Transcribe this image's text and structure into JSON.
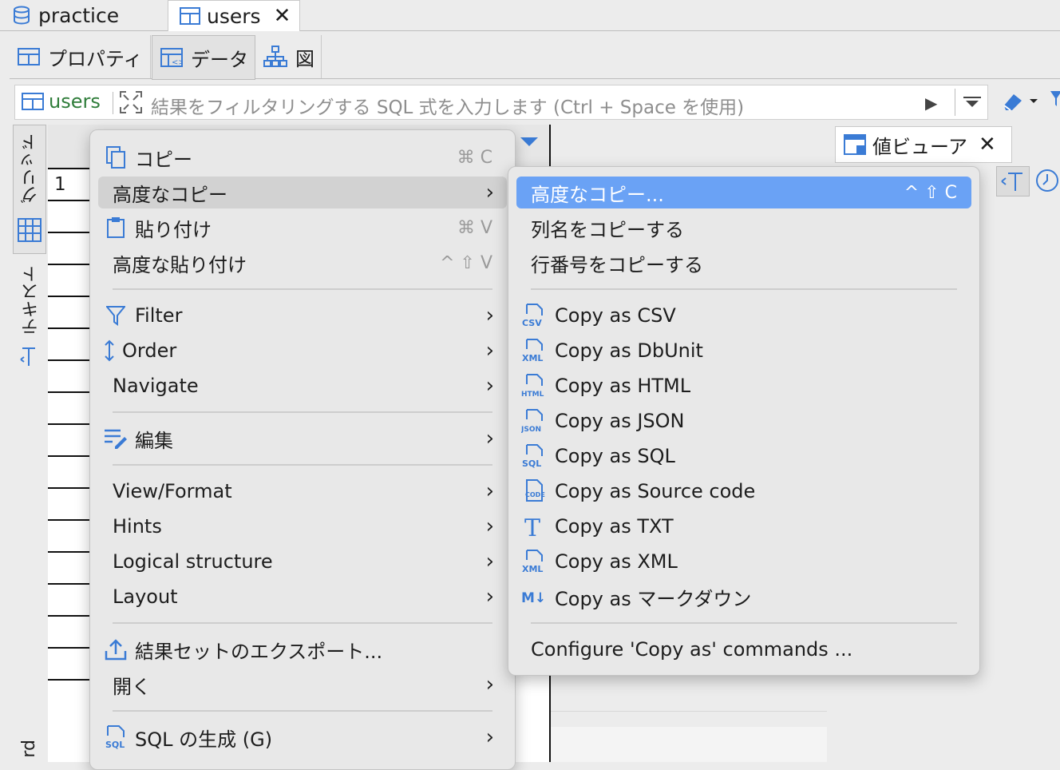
{
  "editor_tabs": [
    {
      "label": "practice",
      "icon": "database-icon"
    },
    {
      "label": "users",
      "icon": "table-icon",
      "close": "✕"
    }
  ],
  "sub_tabs": [
    {
      "label": "プロパティ"
    },
    {
      "label": "データ"
    },
    {
      "label": "図"
    }
  ],
  "filter": {
    "table": "users",
    "placeholder": "結果をフィルタリングする SQL 式を入力します (Ctrl + Space を使用)"
  },
  "grid": {
    "row_number": "1",
    "vertical_tabs": [
      "グリッド",
      "テキスト"
    ],
    "bottom_fragment": "rd"
  },
  "value_viewer": {
    "label": "値ビューア",
    "close": "✕"
  },
  "context_menu": {
    "items": [
      {
        "label": "コピー",
        "shortcut": "⌘ C"
      },
      {
        "label": "高度なコピー",
        "arrow": "›"
      },
      {
        "label": "貼り付け",
        "shortcut": "⌘ V"
      },
      {
        "label": "高度な貼り付け",
        "shortcut": "^ ⇧ V"
      },
      {
        "label": "Filter",
        "arrow": "›"
      },
      {
        "label": "Order",
        "arrow": "›"
      },
      {
        "label": "Navigate",
        "arrow": "›"
      },
      {
        "label": "編集",
        "arrow": "›"
      },
      {
        "label": "View/Format",
        "arrow": "›"
      },
      {
        "label": "Hints",
        "arrow": "›"
      },
      {
        "label": "Logical structure",
        "arrow": "›"
      },
      {
        "label": "Layout",
        "arrow": "›"
      },
      {
        "label": "結果セットのエクスポート...",
        "arrow": ""
      },
      {
        "label": "開く",
        "arrow": "›"
      },
      {
        "label": "SQL の生成 (G)",
        "arrow": "›"
      }
    ]
  },
  "submenu": {
    "items": [
      {
        "label": "高度なコピー...",
        "shortcut": "^ ⇧ C"
      },
      {
        "label": "列名をコピーする"
      },
      {
        "label": "行番号をコピーする"
      },
      {
        "label": "Copy as CSV",
        "badge": "CSV"
      },
      {
        "label": "Copy as DbUnit",
        "badge": "XML"
      },
      {
        "label": "Copy as HTML",
        "badge": "HTML"
      },
      {
        "label": "Copy as JSON",
        "badge": "JSON"
      },
      {
        "label": "Copy as SQL",
        "badge": "SQL"
      },
      {
        "label": "Copy as Source code",
        "badge": "CODE"
      },
      {
        "label": "Copy as TXT",
        "badge": "T"
      },
      {
        "label": "Copy as XML",
        "badge": "XML"
      },
      {
        "label": "Copy as マークダウン",
        "badge": "M↓"
      },
      {
        "label": "Configure 'Copy as' commands ..."
      }
    ]
  },
  "colors": {
    "accent": "#6aa2f5",
    "icon_blue": "#3a7bd5",
    "filter_green": "#2f7d3a"
  }
}
